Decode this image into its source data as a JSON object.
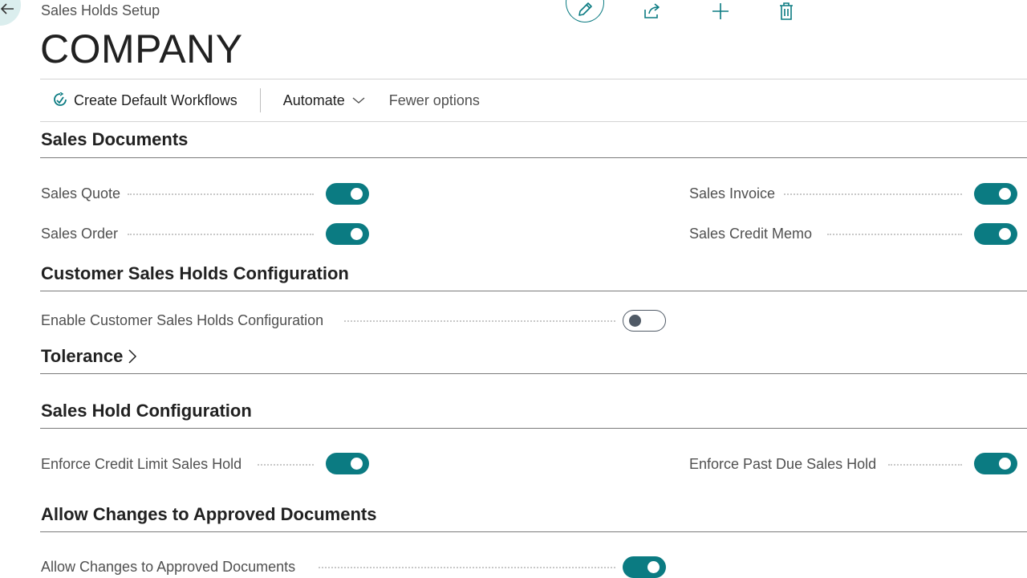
{
  "header": {
    "breadcrumb": "Sales Holds Setup",
    "title": "COMPANY",
    "icons": [
      "back-arrow-icon",
      "edit-icon",
      "share-icon",
      "plus-icon",
      "delete-icon"
    ]
  },
  "action_bar": {
    "create_workflows": "Create Default Workflows",
    "automate": "Automate",
    "fewer_options": "Fewer options"
  },
  "sections": {
    "sales_documents": {
      "title": "Sales Documents",
      "fields": [
        {
          "label": "Sales Quote",
          "value": true
        },
        {
          "label": "Sales Invoice",
          "value": true
        },
        {
          "label": "Sales Order",
          "value": true
        },
        {
          "label": "Sales Credit Memo",
          "value": true
        }
      ]
    },
    "customer_config": {
      "title": "Customer Sales Holds Configuration",
      "fields": [
        {
          "label": "Enable Customer Sales Holds Configuration",
          "value": false
        }
      ]
    },
    "tolerance": {
      "title": "Tolerance"
    },
    "sales_hold_config": {
      "title": "Sales Hold Configuration",
      "fields": [
        {
          "label": "Enforce Credit Limit Sales Hold",
          "value": true
        },
        {
          "label": "Enforce Past Due Sales Hold",
          "value": true
        }
      ]
    },
    "allow_changes": {
      "title": "Allow Changes to Approved Documents",
      "fields": [
        {
          "label": "Allow Changes to Approved Documents",
          "value": true
        }
      ]
    }
  },
  "colors": {
    "accent": "#0b7b82",
    "toggle_off": "#505a66"
  }
}
